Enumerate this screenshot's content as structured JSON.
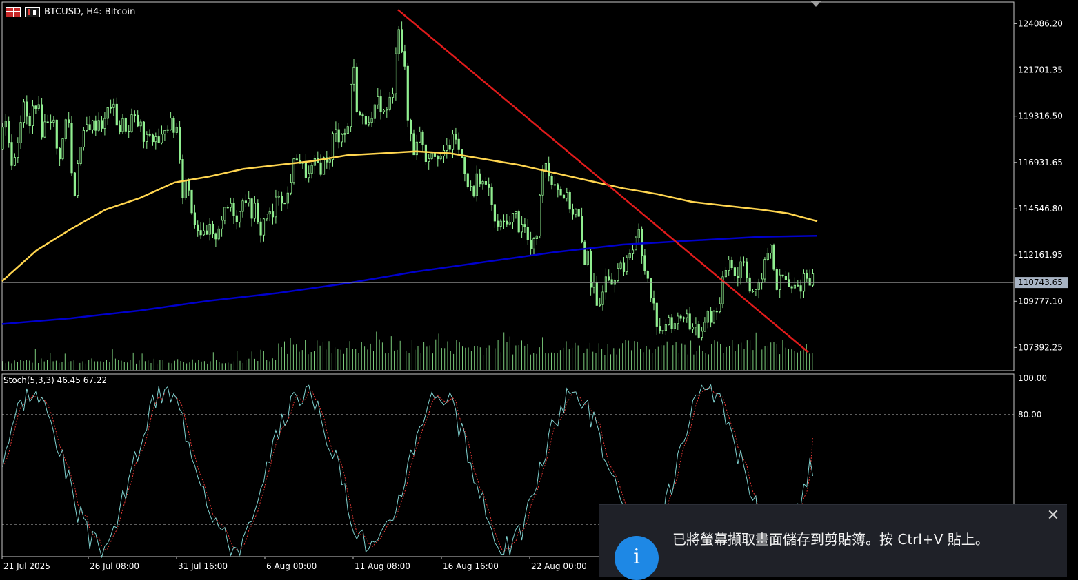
{
  "chart": {
    "symbol_title": "BTCUSD, H4:  Bitcoin",
    "current_price_label": "110743.65",
    "price_ticks": [
      "124086.20",
      "121701.35",
      "119316.50",
      "116931.65",
      "114546.80",
      "112161.95",
      "109777.10",
      "107392.25"
    ],
    "stoch_label": "Stoch(5,3,3) 46.45 67.22",
    "stoch_ticks": [
      "100.00",
      "80.00"
    ],
    "time_labels": [
      "21 Jul 2025",
      "26 Jul 08:00",
      "31 Jul 16:00",
      "6 Aug 00:00",
      "11 Aug 08:00",
      "16 Aug 16:00",
      "22 Aug 00:00"
    ],
    "colors": {
      "background": "#000000",
      "candle": "#90ee90",
      "ma_slow": "#0000cd",
      "ma_fast": "#ffd54f",
      "trendline": "#e01b1b",
      "stoch_main": "#7fd1cf",
      "stoch_signal": "#e53935",
      "price_tag_bg": "#a8b4c4"
    }
  },
  "chart_data": {
    "type": "candlestick",
    "ylim": [
      106200,
      125200
    ],
    "current_price": 110743.65,
    "price_path": [
      [
        0,
        117600
      ],
      [
        6,
        119500
      ],
      [
        12,
        118200
      ],
      [
        18,
        116800
      ],
      [
        24,
        117800
      ],
      [
        30,
        119200
      ],
      [
        36,
        120000
      ],
      [
        42,
        118400
      ],
      [
        48,
        119800
      ],
      [
        54,
        120200
      ],
      [
        60,
        118500
      ],
      [
        66,
        119000
      ],
      [
        72,
        119400
      ],
      [
        78,
        118900
      ],
      [
        84,
        117000
      ],
      [
        90,
        117800
      ],
      [
        96,
        119200
      ],
      [
        100,
        119000
      ],
      [
        104,
        116400
      ],
      [
        108,
        115200
      ],
      [
        112,
        117000
      ],
      [
        116,
        117500
      ],
      [
        120,
        118100
      ],
      [
        126,
        118800
      ],
      [
        132,
        118900
      ],
      [
        138,
        118800
      ],
      [
        144,
        119200
      ],
      [
        150,
        118700
      ],
      [
        156,
        119600
      ],
      [
        162,
        120000
      ],
      [
        168,
        119200
      ],
      [
        174,
        118600
      ],
      [
        180,
        119100
      ],
      [
        186,
        118300
      ],
      [
        192,
        119400
      ],
      [
        198,
        118900
      ],
      [
        204,
        118800
      ],
      [
        210,
        117700
      ],
      [
        216,
        118500
      ],
      [
        222,
        118000
      ],
      [
        228,
        118500
      ],
      [
        232,
        117200
      ],
      [
        236,
        118700
      ],
      [
        240,
        118900
      ],
      [
        246,
        119000
      ],
      [
        252,
        118600
      ],
      [
        256,
        118800
      ],
      [
        262,
        117000
      ],
      [
        266,
        114700
      ],
      [
        270,
        116200
      ],
      [
        276,
        115200
      ],
      [
        280,
        114000
      ],
      [
        286,
        113700
      ],
      [
        292,
        113300
      ],
      [
        298,
        112900
      ],
      [
        304,
        113500
      ],
      [
        310,
        112800
      ],
      [
        316,
        113600
      ],
      [
        322,
        114100
      ],
      [
        328,
        114400
      ],
      [
        334,
        114900
      ],
      [
        340,
        114300
      ],
      [
        346,
        114000
      ],
      [
        352,
        115200
      ],
      [
        358,
        115100
      ],
      [
        364,
        114300
      ],
      [
        370,
        114600
      ],
      [
        376,
        113100
      ],
      [
        382,
        113900
      ],
      [
        388,
        114500
      ],
      [
        394,
        113800
      ],
      [
        400,
        114900
      ],
      [
        406,
        115600
      ],
      [
        412,
        114600
      ],
      [
        418,
        115400
      ],
      [
        424,
        116600
      ],
      [
        430,
        117300
      ],
      [
        436,
        116900
      ],
      [
        442,
        116400
      ],
      [
        448,
        116200
      ],
      [
        454,
        116700
      ],
      [
        460,
        116900
      ],
      [
        466,
        116600
      ],
      [
        472,
        117300
      ],
      [
        478,
        116900
      ],
      [
        484,
        118700
      ],
      [
        490,
        118200
      ],
      [
        496,
        118600
      ],
      [
        502,
        118300
      ],
      [
        506,
        119200
      ],
      [
        510,
        122000
      ],
      [
        514,
        121500
      ],
      [
        518,
        119500
      ],
      [
        522,
        119300
      ],
      [
        528,
        119000
      ],
      [
        534,
        119400
      ],
      [
        540,
        118900
      ],
      [
        546,
        120100
      ],
      [
        552,
        119900
      ],
      [
        558,
        119300
      ],
      [
        564,
        120100
      ],
      [
        570,
        120300
      ],
      [
        574,
        122900
      ],
      [
        577,
        124600
      ],
      [
        580,
        123200
      ],
      [
        584,
        122600
      ],
      [
        588,
        121200
      ],
      [
        592,
        118600
      ],
      [
        596,
        118400
      ],
      [
        600,
        117500
      ],
      [
        606,
        118500
      ],
      [
        612,
        118200
      ],
      [
        618,
        117000
      ],
      [
        624,
        117600
      ],
      [
        630,
        117500
      ],
      [
        636,
        117400
      ],
      [
        642,
        117100
      ],
      [
        648,
        117700
      ],
      [
        654,
        117800
      ],
      [
        660,
        118400
      ],
      [
        666,
        117300
      ],
      [
        672,
        117100
      ],
      [
        676,
        116000
      ],
      [
        680,
        115900
      ],
      [
        686,
        115000
      ],
      [
        692,
        116300
      ],
      [
        698,
        116100
      ],
      [
        704,
        115500
      ],
      [
        710,
        115700
      ],
      [
        716,
        113700
      ],
      [
        722,
        113700
      ],
      [
        728,
        113600
      ],
      [
        734,
        114100
      ],
      [
        740,
        113700
      ],
      [
        746,
        114500
      ],
      [
        752,
        113600
      ],
      [
        758,
        114000
      ],
      [
        764,
        113000
      ],
      [
        770,
        112400
      ],
      [
        776,
        112800
      ],
      [
        780,
        113700
      ],
      [
        786,
        116700
      ],
      [
        790,
        117200
      ],
      [
        794,
        116400
      ],
      [
        798,
        116300
      ],
      [
        802,
        115800
      ],
      [
        806,
        116000
      ],
      [
        812,
        115300
      ],
      [
        818,
        115300
      ],
      [
        824,
        114900
      ],
      [
        830,
        114400
      ],
      [
        836,
        114400
      ],
      [
        840,
        113900
      ],
      [
        844,
        112400
      ],
      [
        848,
        111600
      ],
      [
        852,
        112700
      ],
      [
        856,
        110700
      ],
      [
        860,
        110800
      ],
      [
        864,
        109300
      ],
      [
        868,
        109200
      ],
      [
        872,
        110200
      ],
      [
        876,
        110900
      ],
      [
        880,
        111600
      ],
      [
        886,
        110800
      ],
      [
        892,
        111200
      ],
      [
        898,
        112200
      ],
      [
        904,
        110900
      ],
      [
        910,
        112100
      ],
      [
        916,
        112600
      ],
      [
        922,
        113100
      ],
      [
        926,
        113300
      ],
      [
        930,
        112100
      ],
      [
        934,
        111500
      ],
      [
        940,
        111000
      ],
      [
        946,
        109800
      ],
      [
        952,
        108800
      ],
      [
        956,
        108500
      ],
      [
        960,
        107800
      ],
      [
        966,
        108800
      ],
      [
        972,
        108600
      ],
      [
        978,
        108800
      ],
      [
        984,
        108700
      ],
      [
        990,
        109200
      ],
      [
        996,
        109000
      ],
      [
        1002,
        108300
      ],
      [
        1008,
        108900
      ],
      [
        1012,
        107800
      ],
      [
        1016,
        107500
      ],
      [
        1020,
        108500
      ],
      [
        1026,
        109400
      ],
      [
        1032,
        108600
      ],
      [
        1038,
        109500
      ],
      [
        1044,
        109500
      ],
      [
        1048,
        110700
      ],
      [
        1052,
        111400
      ],
      [
        1056,
        112100
      ],
      [
        1062,
        111700
      ],
      [
        1068,
        110800
      ],
      [
        1074,
        111800
      ],
      [
        1080,
        112000
      ],
      [
        1086,
        110400
      ],
      [
        1092,
        110300
      ],
      [
        1098,
        110000
      ],
      [
        1104,
        111100
      ],
      [
        1110,
        111800
      ],
      [
        1116,
        112600
      ],
      [
        1120,
        112700
      ],
      [
        1124,
        110300
      ],
      [
        1130,
        110800
      ],
      [
        1136,
        111100
      ],
      [
        1142,
        110600
      ],
      [
        1148,
        110300
      ],
      [
        1154,
        110600
      ],
      [
        1160,
        110400
      ],
      [
        1166,
        111200
      ],
      [
        1172,
        110900
      ],
      [
        1178,
        111000
      ],
      [
        1182,
        110743.65
      ]
    ],
    "ma_fast_path": [
      [
        0,
        110810
      ],
      [
        50,
        112400
      ],
      [
        100,
        113500
      ],
      [
        150,
        114500
      ],
      [
        200,
        115100
      ],
      [
        250,
        115900
      ],
      [
        300,
        116200
      ],
      [
        350,
        116600
      ],
      [
        400,
        116800
      ],
      [
        450,
        117000
      ],
      [
        500,
        117300
      ],
      [
        550,
        117400
      ],
      [
        600,
        117500
      ],
      [
        650,
        117400
      ],
      [
        700,
        117100
      ],
      [
        750,
        116800
      ],
      [
        800,
        116400
      ],
      [
        850,
        116000
      ],
      [
        900,
        115600
      ],
      [
        950,
        115300
      ],
      [
        1000,
        114900
      ],
      [
        1050,
        114700
      ],
      [
        1100,
        114500
      ],
      [
        1140,
        114300
      ],
      [
        1182,
        113900
      ]
    ],
    "ma_slow_path": [
      [
        0,
        108600
      ],
      [
        100,
        108900
      ],
      [
        200,
        109300
      ],
      [
        300,
        109800
      ],
      [
        400,
        110200
      ],
      [
        500,
        110700
      ],
      [
        600,
        111300
      ],
      [
        700,
        111800
      ],
      [
        800,
        112300
      ],
      [
        850,
        112500
      ],
      [
        900,
        112700
      ],
      [
        950,
        112800
      ],
      [
        1000,
        112900
      ],
      [
        1050,
        113000
      ],
      [
        1100,
        113100
      ],
      [
        1182,
        113150
      ]
    ],
    "trendline": {
      "from": [
        577,
        124800
      ],
      "to": [
        1172,
        107150
      ]
    },
    "stoch_ylim": [
      0,
      100
    ],
    "stoch_levels": [
      80,
      20
    ],
    "stoch_main": [
      55,
      33,
      5,
      28,
      35,
      19,
      8,
      64,
      47,
      4,
      8,
      24,
      66,
      58,
      47,
      43,
      63,
      68,
      39,
      10
    ],
    "stoch_signal": [
      48,
      39,
      16,
      22,
      31,
      24,
      12,
      50,
      52,
      16,
      10,
      18,
      52,
      58,
      51,
      47,
      58,
      63,
      47,
      22
    ],
    "stoch_current": {
      "main": 46.45,
      "signal": 67.22
    }
  },
  "toast": {
    "message": "已將螢幕擷取畫面儲存到剪貼簿。按 Ctrl+V 貼上。",
    "close_glyph": "✕",
    "info_glyph": "i"
  }
}
